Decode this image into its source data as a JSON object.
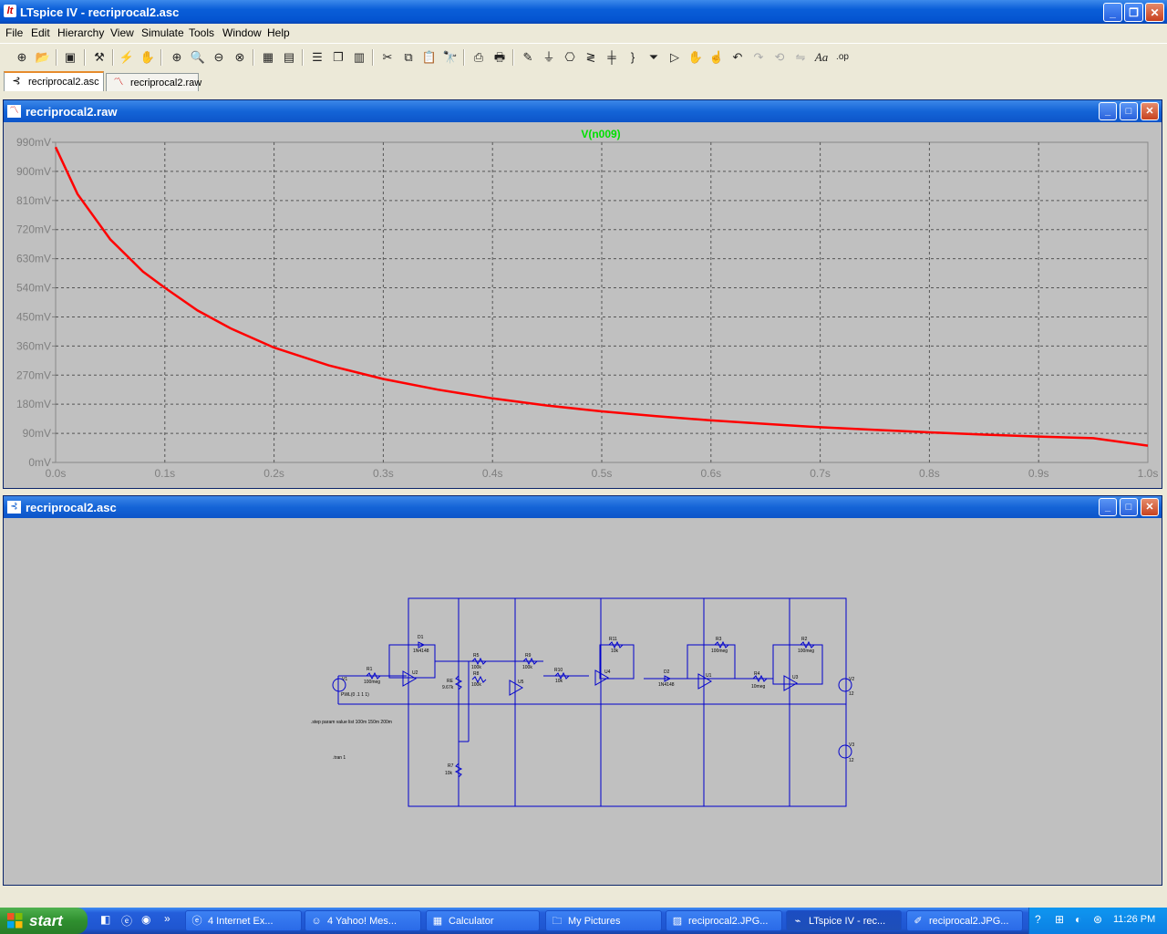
{
  "window": {
    "title": "LTspice IV - recriprocal2.asc",
    "minimize": "_",
    "restore": "❐",
    "close": "✕"
  },
  "menu": [
    "File",
    "Edit",
    "Hierarchy",
    "View",
    "Simulate",
    "Tools",
    "Window",
    "Help"
  ],
  "toolbar_icons": [
    "new-schematic-icon",
    "open-icon",
    "save-icon",
    "control-panel-icon",
    "run-icon",
    "halt-icon",
    "zoom-in-icon",
    "zoom-pan-icon",
    "zoom-out-icon",
    "zoom-fit-icon",
    "autorange-icon",
    "grid-icon",
    "tile-horizontal-icon",
    "cascade-icon",
    "tile-vertical-icon",
    "cut-icon",
    "copy-icon",
    "paste-icon",
    "find-icon",
    "print-setup-icon",
    "print-icon",
    "draw-wire-icon",
    "ground-icon",
    "label-net-icon",
    "resistor-icon",
    "capacitor-icon",
    "inductor-icon",
    "diode-icon",
    "component-icon",
    "move-icon",
    "drag-icon",
    "undo-icon",
    "redo-icon",
    "rotate-icon",
    "mirror-icon",
    "text-icon",
    "spice-directive-icon"
  ],
  "toolbar_glyphs": {
    "text": "Aa",
    "spice": ".op"
  },
  "tabs": [
    {
      "label": "recriprocal2.asc",
      "icon": "schematic-icon"
    },
    {
      "label": "recriprocal2.raw",
      "icon": "waveform-icon"
    }
  ],
  "waveform_window": {
    "title": "recriprocal2.raw",
    "trace_label": "V(n009)",
    "trace_color": "#ff0000",
    "label_color": "#00e000",
    "chart_data": {
      "type": "line",
      "title": "V(n009)",
      "xlim": [
        0,
        1.0
      ],
      "ylim": [
        0,
        990
      ],
      "x_tick_labels": [
        "0.0s",
        "0.1s",
        "0.2s",
        "0.3s",
        "0.4s",
        "0.5s",
        "0.6s",
        "0.7s",
        "0.8s",
        "0.9s",
        "1.0s"
      ],
      "y_tick_labels": [
        "990mV",
        "900mV",
        "810mV",
        "720mV",
        "630mV",
        "540mV",
        "450mV",
        "360mV",
        "270mV",
        "180mV",
        "90mV",
        "0mV"
      ],
      "grid": true,
      "series": [
        {
          "name": "V(n009)",
          "x": [
            0.0,
            0.02,
            0.05,
            0.08,
            0.1,
            0.13,
            0.16,
            0.2,
            0.25,
            0.3,
            0.35,
            0.4,
            0.45,
            0.5,
            0.55,
            0.6,
            0.65,
            0.7,
            0.75,
            0.8,
            0.85,
            0.9,
            0.95,
            1.0
          ],
          "y": [
            975,
            830,
            690,
            590,
            540,
            470,
            415,
            355,
            300,
            258,
            225,
            198,
            176,
            158,
            143,
            130,
            119,
            109,
            101,
            93,
            86,
            80,
            75,
            52
          ]
        }
      ]
    }
  },
  "schematic_window": {
    "title": "recriprocal2.asc",
    "labels": {
      "D1": "D1",
      "D1v": "1N4148",
      "D2": "D2",
      "D2v": "1N4148",
      "R1": "R1",
      "R1v": "100meg",
      "R2": "R2",
      "R2v": "100meg",
      "R3": "R3",
      "R3v": "100meg",
      "R4": "R4",
      "R4v": "10meg",
      "R5": "R5",
      "R5v": "100k",
      "R6": "R6",
      "R6v": "100k",
      "R7": "R7",
      "R7v": "10k",
      "R8": "R8",
      "R8v": "100k",
      "R9": "R9",
      "R9v": "100k",
      "R10": "R10",
      "R10v": "10k",
      "R11": "R11",
      "R11v": "10k",
      "RE": "RE",
      "REv": "9.67k",
      "U1": "U1",
      "U2": "U2",
      "U3": "U3",
      "U4": "U4",
      "U5": "U5",
      "V1": "V1",
      "V1v": "PWL(0 .1 1 1)",
      "V2": "V2",
      "V2v": "12",
      "V3": "V3",
      "V3v": "12",
      "step": ".step param value list  100m 150m 200m",
      "tran": ".tran 1"
    }
  },
  "taskbar": {
    "start": "start",
    "quicklaunch_more": "»",
    "tasks": [
      {
        "label": "4 Internet Ex...",
        "icon": "ie-icon"
      },
      {
        "label": "4 Yahoo! Mes...",
        "icon": "yahoo-icon"
      },
      {
        "label": "Calculator",
        "icon": "calculator-icon"
      },
      {
        "label": "My Pictures",
        "icon": "folder-icon"
      },
      {
        "label": "reciprocal2.JPG...",
        "icon": "image-icon"
      },
      {
        "label": "LTspice IV - rec...",
        "icon": "ltspice-icon"
      },
      {
        "label": "reciprocal2.JPG...",
        "icon": "paint-icon"
      }
    ],
    "clock": "11:26 PM"
  }
}
